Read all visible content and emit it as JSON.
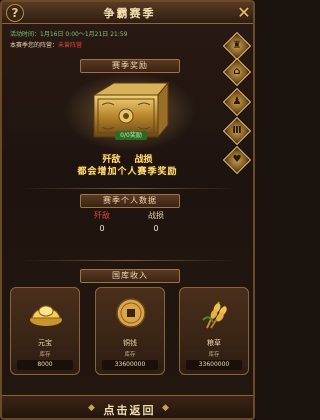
{
  "header": {
    "title": "争霸赛季",
    "help_icon": "?",
    "close_icon": "✕"
  },
  "info": {
    "activity_time": "活动时间：1月16日 0:00～1月21日 21:59",
    "camp_label": "本赛季您的阵营：",
    "camp_value": "未曾阵营"
  },
  "side_buttons": [
    "side-btn-1",
    "side-btn-2",
    "side-btn-3",
    "side-btn-4",
    "side-btn-5"
  ],
  "reward": {
    "banner": "赛季奖励",
    "chest_label": "0/0奖励",
    "line1_a": "歼敌",
    "line1_b": "战损",
    "line2": "都会增加个人赛季奖励"
  },
  "stats": {
    "banner": "赛季个人数据",
    "kills_label": "歼敌",
    "kills_value": "0",
    "losses_label": "战损",
    "losses_value": "0"
  },
  "income": {
    "banner": "国库收入",
    "cards": [
      {
        "name": "元宝",
        "sub": "库存",
        "value": "8000",
        "icon": "gold-ingot-icon"
      },
      {
        "name": "铜钱",
        "sub": "库存",
        "value": "33600000",
        "icon": "copper-coin-icon"
      },
      {
        "name": "粮草",
        "sub": "库存",
        "value": "33600000",
        "icon": "grain-icon"
      }
    ]
  },
  "back": {
    "label": "点击返回"
  },
  "colors": {
    "gold": "#ffe27a",
    "red": "#e0463a",
    "green": "#7fc37a",
    "panel": "#2a1a12"
  }
}
